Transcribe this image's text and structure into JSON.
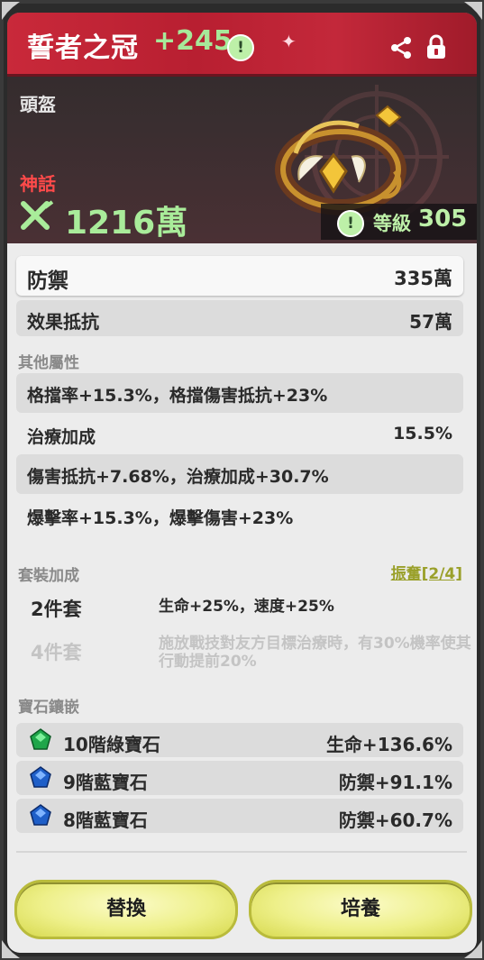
{
  "header": {
    "title": "誓者之冠",
    "enhance": "+245",
    "slot": "頭盔",
    "rarity": "神話",
    "power": "1216萬",
    "level_label": "等級",
    "level_value": "305",
    "info_glyph": "!"
  },
  "main_stat": {
    "label": "防禦",
    "value": "335萬"
  },
  "sub_stat": {
    "label": "效果抵抗",
    "value": "57萬"
  },
  "other_section": {
    "title": "其他屬性",
    "rows": [
      {
        "label": "格擋率+15.3%，格擋傷害抵抗+23%",
        "value": ""
      },
      {
        "label": "治療加成",
        "value": "15.5%"
      },
      {
        "label": "傷害抵抗+7.68%，治療加成+30.7%",
        "value": ""
      },
      {
        "label": "爆擊率+15.3%，爆擊傷害+23%",
        "value": ""
      }
    ]
  },
  "set_section": {
    "title": "套裝加成",
    "link": "振奮[2/4]",
    "items": [
      {
        "count": "2件套",
        "desc": "生命+25%，速度+25%"
      },
      {
        "count": "4件套",
        "desc": "施放戰技對友方目標治療時，有30%機率使其行動提前20%"
      }
    ]
  },
  "gem_section": {
    "title": "寶石鑲嵌",
    "gems": [
      {
        "name": "10階綠寶石",
        "value": "生命+136.6%",
        "icon": "green-gem-icon"
      },
      {
        "name": "9階藍寶石",
        "value": "防禦+91.1%",
        "icon": "blue-gem-icon"
      },
      {
        "name": "8階藍寶石",
        "value": "防禦+60.7%",
        "icon": "blue-gem-icon"
      }
    ]
  },
  "buttons": {
    "replace": "替換",
    "cultivate": "培養"
  },
  "colors": {
    "title_bar": "#c9293a",
    "rarity": "#ff4a4a",
    "green_text": "#a9ec9a",
    "button": "#eef08a",
    "link": "#9aa02a"
  }
}
